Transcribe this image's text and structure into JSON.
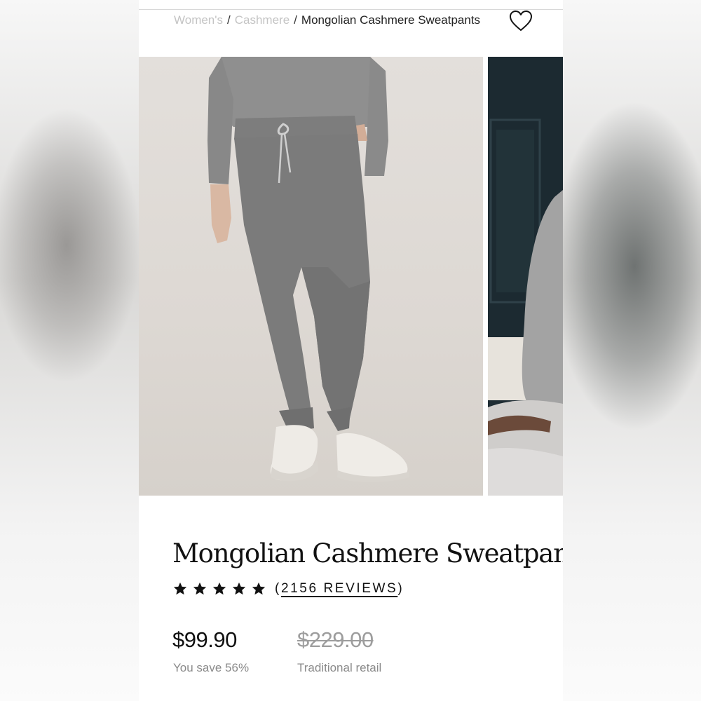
{
  "breadcrumb": {
    "items": [
      "Women's",
      "Cashmere"
    ],
    "separator": "/",
    "current": "Mongolian Cashmere Sweatpants"
  },
  "icons": {
    "wishlist": "heart-icon",
    "rating": "star-icon"
  },
  "gallery": {
    "images": [
      "model wearing grey cashmere sweatpants and white sneakers",
      "seated model in grey cashmere on a faux-fur rug"
    ]
  },
  "product": {
    "title": "Mongolian Cashmere Sweatpants",
    "rating": 5,
    "rating_max": 5,
    "reviews_open": "(",
    "reviews_label": "2156 REVIEWS",
    "reviews_close": ")",
    "price": "$99.90",
    "savings": "You save 56%",
    "retail_price": "$229.00",
    "retail_label": "Traditional retail"
  },
  "colors": {
    "text": "#111111",
    "muted": "#8a8a8a",
    "breadcrumb_muted": "#c4c4c4"
  }
}
